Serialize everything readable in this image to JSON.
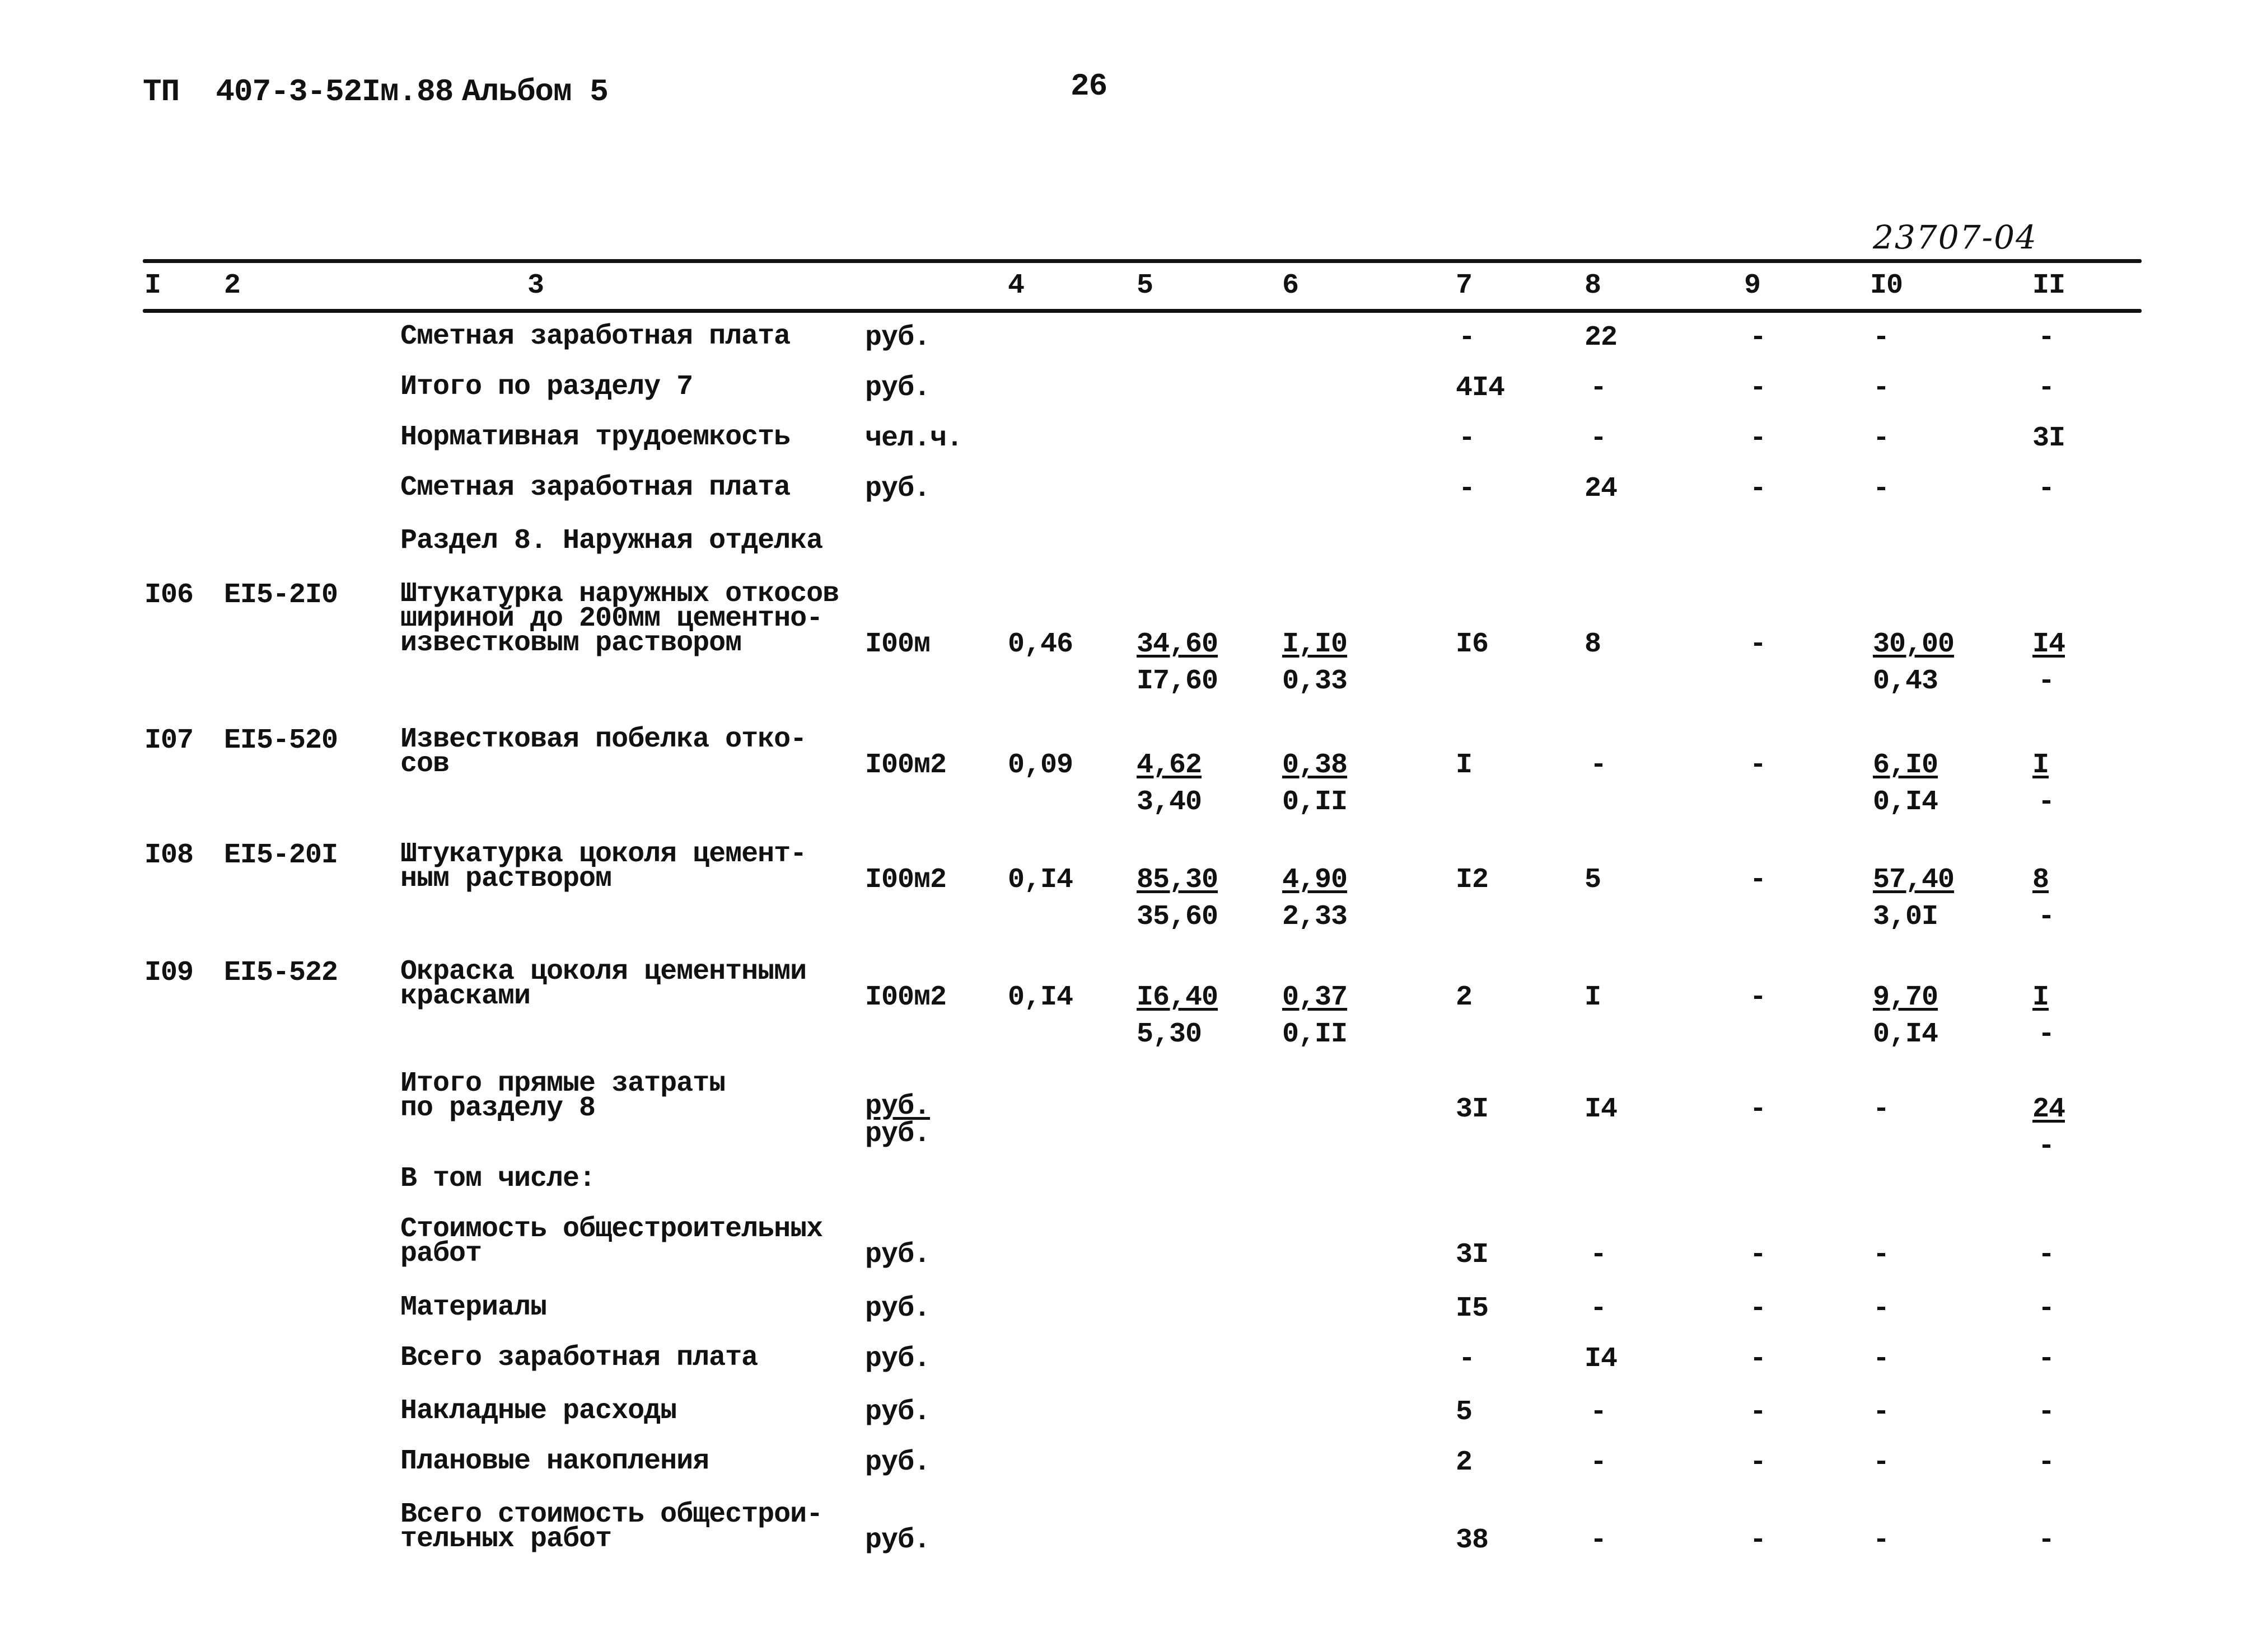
{
  "header": {
    "doc_code": "ТП  407-3-52Iм.88",
    "album": "Альбом 5",
    "page_number": "26",
    "handwritten_ref": "23707-04"
  },
  "table": {
    "columns": [
      "I",
      "2",
      "3",
      "4",
      "5",
      "6",
      "7",
      "8",
      "9",
      "I0",
      "II"
    ],
    "rows": [
      {
        "num": "",
        "code": "",
        "desc": "Сметная заработная плата",
        "unit": "руб.",
        "qty": "",
        "c5": "",
        "c5b": "",
        "c6": "",
        "c6b": "",
        "c7": "-",
        "c8": "22",
        "c9": "-",
        "c10": "-",
        "c10b": "",
        "c11": "-",
        "c11b": ""
      },
      {
        "num": "",
        "code": "",
        "desc": "Итого по разделу 7",
        "unit": "руб.",
        "qty": "",
        "c5": "",
        "c5b": "",
        "c6": "",
        "c6b": "",
        "c7": "4I4",
        "c8": "-",
        "c9": "-",
        "c10": "-",
        "c10b": "",
        "c11": "-",
        "c11b": ""
      },
      {
        "num": "",
        "code": "",
        "desc": "Нормативная трудоемкость",
        "unit": "чел.ч.",
        "qty": "",
        "c5": "",
        "c5b": "",
        "c6": "",
        "c6b": "",
        "c7": "-",
        "c8": "-",
        "c9": "-",
        "c10": "-",
        "c10b": "",
        "c11": "3I",
        "c11b": ""
      },
      {
        "num": "",
        "code": "",
        "desc": "Сметная заработная плата",
        "unit": "руб.",
        "qty": "",
        "c5": "",
        "c5b": "",
        "c6": "",
        "c6b": "",
        "c7": "-",
        "c8": "24",
        "c9": "-",
        "c10": "-",
        "c10b": "",
        "c11": "-",
        "c11b": ""
      },
      {
        "num": "",
        "code": "",
        "desc": "Раздел 8. Наружная отделка",
        "unit": "",
        "qty": "",
        "c5": "",
        "c5b": "",
        "c6": "",
        "c6b": "",
        "c7": "",
        "c8": "",
        "c9": "",
        "c10": "",
        "c10b": "",
        "c11": "",
        "c11b": ""
      },
      {
        "num": "I06",
        "code": "EI5-2I0",
        "desc": "Штукатурка наружных откосов\nшириной до 200мм цементно-\nизвестковым раствором",
        "unit": "I00м",
        "qty": "0,46",
        "c5": "34,60",
        "c5b": "I7,60",
        "c6": "I,I0",
        "c6b": "0,33",
        "c7": "I6",
        "c8": "8",
        "c9": "-",
        "c10": "30,00",
        "c10b": "0,43",
        "c11": "I4",
        "c11b": "-"
      },
      {
        "num": "I07",
        "code": "EI5-520",
        "desc": "Известковая побелка отко-\nсов",
        "unit": "I00м2",
        "qty": "0,09",
        "c5": "4,62",
        "c5b": "3,40",
        "c6": "0,38",
        "c6b": "0,II",
        "c7": "I",
        "c8": "-",
        "c9": "-",
        "c10": "6,I0",
        "c10b": "0,I4",
        "c11": "I",
        "c11b": "-"
      },
      {
        "num": "I08",
        "code": "EI5-20I",
        "desc": "Штукатурка цоколя цемент-\nным раствором",
        "unit": "I00м2",
        "qty": "0,I4",
        "c5": "85,30",
        "c5b": "35,60",
        "c6": "4,90",
        "c6b": "2,33",
        "c7": "I2",
        "c8": "5",
        "c9": "-",
        "c10": "57,40",
        "c10b": "3,0I",
        "c11": "8",
        "c11b": "-"
      },
      {
        "num": "I09",
        "code": "EI5-522",
        "desc": "Окраска цоколя цементными\nкрасками",
        "unit": "I00м2",
        "qty": "0,I4",
        "c5": "I6,40",
        "c5b": "5,30",
        "c6": "0,37",
        "c6b": "0,II",
        "c7": "2",
        "c8": "I",
        "c9": "-",
        "c10": "9,70",
        "c10b": "0,I4",
        "c11": "I",
        "c11b": "-"
      },
      {
        "num": "",
        "code": "",
        "desc": "Итого прямые затраты\nпо разделу 8",
        "unit": "руб.",
        "unit2": "руб.",
        "qty": "",
        "c5": "",
        "c5b": "",
        "c6": "",
        "c6b": "",
        "c7": "3I",
        "c8": "I4",
        "c9": "-",
        "c10": "-",
        "c10b": "",
        "c11": "24",
        "c11b": "-"
      },
      {
        "num": "",
        "code": "",
        "desc": "В том числе:",
        "unit": "",
        "qty": "",
        "c5": "",
        "c5b": "",
        "c6": "",
        "c6b": "",
        "c7": "",
        "c8": "",
        "c9": "",
        "c10": "",
        "c10b": "",
        "c11": "",
        "c11b": ""
      },
      {
        "num": "",
        "code": "",
        "desc": "Стоимость общестроительных\nработ",
        "unit": "руб.",
        "qty": "",
        "c5": "",
        "c5b": "",
        "c6": "",
        "c6b": "",
        "c7": "3I",
        "c8": "-",
        "c9": "-",
        "c10": "-",
        "c10b": "",
        "c11": "-",
        "c11b": ""
      },
      {
        "num": "",
        "code": "",
        "desc": "Материалы",
        "unit": "руб.",
        "qty": "",
        "c5": "",
        "c5b": "",
        "c6": "",
        "c6b": "",
        "c7": "I5",
        "c8": "-",
        "c9": "-",
        "c10": "-",
        "c10b": "",
        "c11": "-",
        "c11b": ""
      },
      {
        "num": "",
        "code": "",
        "desc": "Всего заработная плата",
        "unit": "руб.",
        "qty": "",
        "c5": "",
        "c5b": "",
        "c6": "",
        "c6b": "",
        "c7": "-",
        "c8": "I4",
        "c9": "-",
        "c10": "-",
        "c10b": "",
        "c11": "-",
        "c11b": ""
      },
      {
        "num": "",
        "code": "",
        "desc": "Накладные расходы",
        "unit": "руб.",
        "qty": "",
        "c5": "",
        "c5b": "",
        "c6": "",
        "c6b": "",
        "c7": "5",
        "c8": "-",
        "c9": "-",
        "c10": "-",
        "c10b": "",
        "c11": "-",
        "c11b": ""
      },
      {
        "num": "",
        "code": "",
        "desc": "Плановые накопления",
        "unit": "руб.",
        "qty": "",
        "c5": "",
        "c5b": "",
        "c6": "",
        "c6b": "",
        "c7": "2",
        "c8": "-",
        "c9": "-",
        "c10": "-",
        "c10b": "",
        "c11": "-",
        "c11b": ""
      },
      {
        "num": "",
        "code": "",
        "desc": "Всего стоимость общестрои-\nтельных работ",
        "unit": "руб.",
        "qty": "",
        "c5": "",
        "c5b": "",
        "c6": "",
        "c6b": "",
        "c7": "38",
        "c8": "-",
        "c9": "-",
        "c10": "-",
        "c10b": "",
        "c11": "-",
        "c11b": ""
      }
    ]
  }
}
